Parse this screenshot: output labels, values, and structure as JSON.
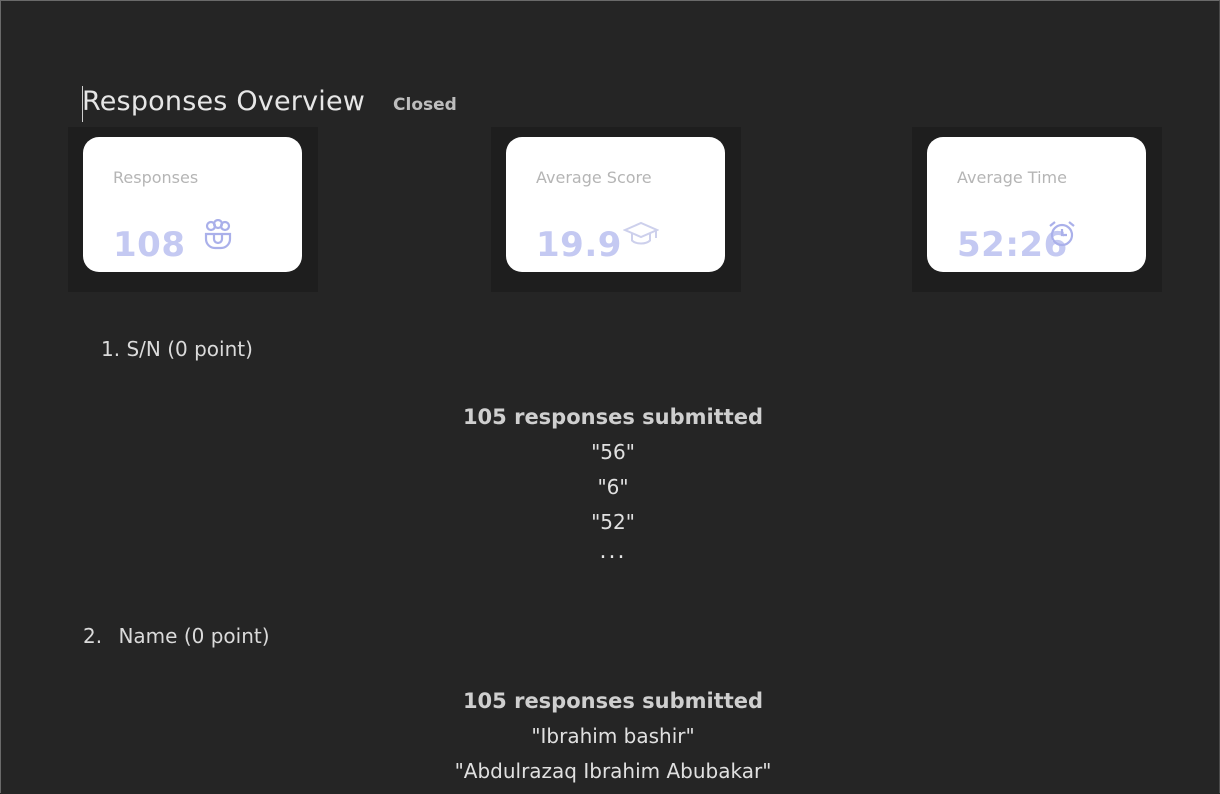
{
  "header": {
    "title": "Responses Overview",
    "status": "Closed"
  },
  "cards": {
    "responses": {
      "label": "Responses",
      "value": "108",
      "icon": "people-icon"
    },
    "average_score": {
      "label": "Average Score",
      "value": "19.9",
      "icon": "graduation-cap-icon"
    },
    "average_time": {
      "label": "Average Time",
      "value": "52:26",
      "icon": "alarm-clock-icon"
    }
  },
  "accent_color": "#c4c9f2",
  "questions": [
    {
      "number": "1.",
      "title": "S/N (0 point)",
      "count": "105 responses submitted",
      "responses": [
        "\"56\"",
        "\"6\"",
        "\"52\""
      ],
      "more": "..."
    },
    {
      "number": "2.",
      "title": "Name (0 point)",
      "count": "105 responses submitted",
      "responses": [
        "\"Ibrahim bashir\"",
        "\"Abdulrazaq Ibrahim Abubakar\""
      ]
    }
  ]
}
